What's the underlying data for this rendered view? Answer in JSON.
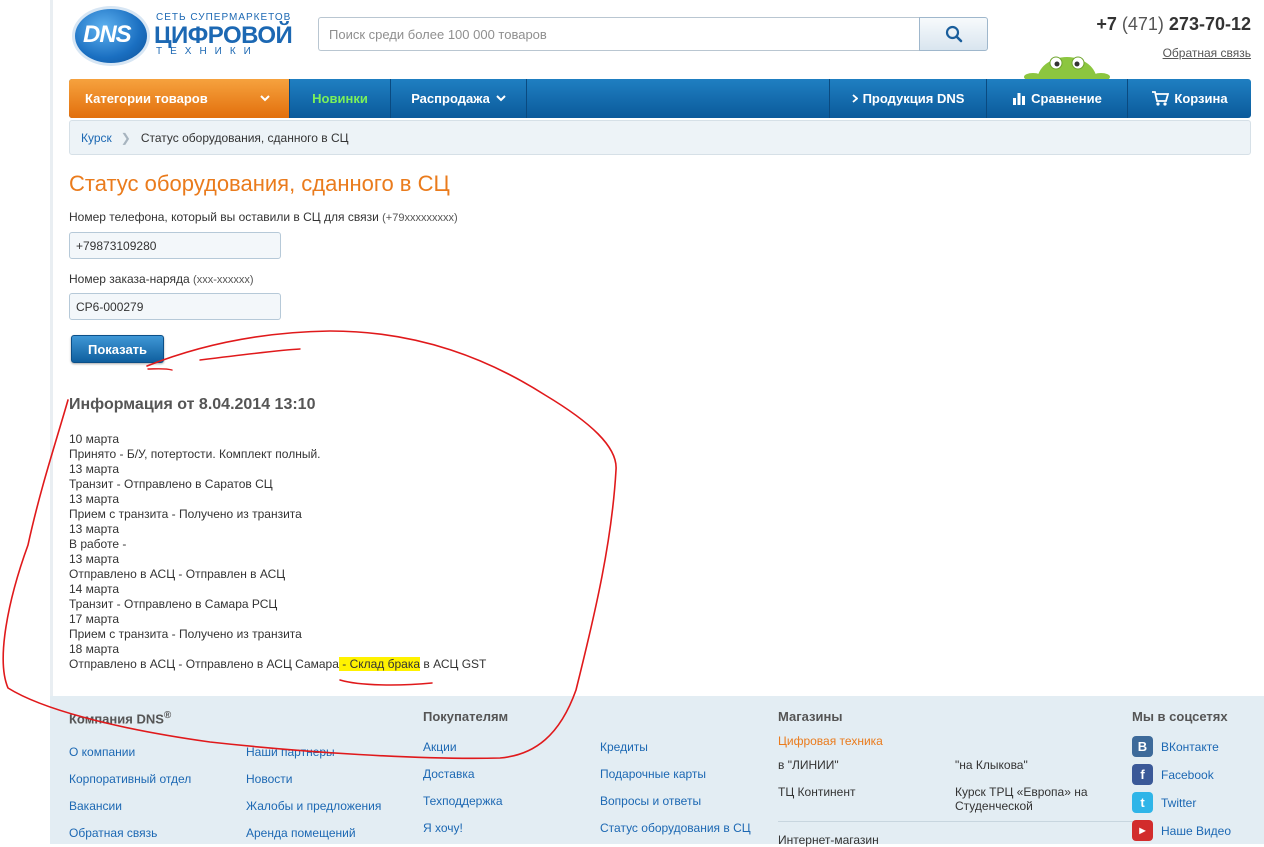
{
  "header": {
    "logo": {
      "brand": "DNS",
      "line1": "СЕТЬ СУПЕРМАРКЕТОВ",
      "line2": "ЦИФРОВОЙ",
      "line3": "ТЕХНИКИ"
    },
    "search_placeholder": "Поиск среди более 100 000 товаров",
    "phone_prefix": "+7",
    "phone_code": "(471)",
    "phone_number": "273-70-12",
    "feedback_link": "Обратная связь"
  },
  "nav": {
    "categories": "Категории товаров",
    "new": "Новинки",
    "sale": "Распродажа",
    "products": "Продукция DNS",
    "compare": "Сравнение",
    "cart": "Корзина"
  },
  "breadcrumb": {
    "home": "Курск",
    "current": "Статус оборудования, сданного в СЦ"
  },
  "form": {
    "title": "Статус оборудования, сданного в СЦ",
    "phone_label": "Номер телефона, который вы оставили в СЦ для связи",
    "phone_hint": "(+79xxxxxxxxx)",
    "phone_value": "+79873109280",
    "order_label": "Номер заказа-наряда",
    "order_hint": "(xxx-xxxxxx)",
    "order_value": "CP6-000279",
    "submit": "Показать"
  },
  "info": {
    "title": "Информация от 8.04.2014 13:10",
    "history": [
      "10 марта",
      "Принято - Б/У, потертости. Комплект полный.",
      "13 марта",
      "Транзит - Отправлено в Саратов СЦ",
      "13 марта",
      "Прием с транзита - Получено из транзита",
      "13 марта",
      "В работе -",
      "13 марта",
      "Отправлено в АСЦ - Отправлен в АСЦ",
      "14 марта",
      "Транзит - Отправлено в Самара РСЦ",
      "17 марта",
      "Прием с транзита - Получено из транзита",
      "18 марта"
    ],
    "last_pre": "Отправлено в АСЦ - Отправлено в АСЦ Самара",
    "last_highlight": " - Склад брака",
    "last_post": " в АСЦ GST"
  },
  "footer": {
    "company": {
      "title": "Компания DNS",
      "reg": "®",
      "col1": [
        "О компании",
        "Корпоративный отдел",
        "Вакансии",
        "Обратная связь"
      ],
      "col2": [
        "Наши партнеры",
        "Новости",
        "Жалобы и предложения",
        "Аренда помещений"
      ]
    },
    "buyers": {
      "title": "Покупателям",
      "col1": [
        "Акции",
        "Доставка",
        "Техподдержка",
        "Я хочу!"
      ],
      "col2": [
        "Кредиты",
        "Подарочные карты",
        "Вопросы и ответы",
        "Статус оборудования в СЦ"
      ]
    },
    "stores": {
      "title": "Магазины",
      "digital": "Цифровая техника",
      "s1": "в \"ЛИНИИ\"",
      "s2": "\"на Клыкова\"",
      "s3": "ТЦ Континент",
      "s4": "Курск ТРЦ «Европа» на Студенческой",
      "online": "Интернет-магазин"
    },
    "social": {
      "title": "Мы в соцсетях",
      "vk": "ВКонтакте",
      "fb": "Facebook",
      "tw": "Twitter",
      "yt": "Наше Видео"
    }
  },
  "colors": {
    "accent_orange": "#ea7b1c",
    "nav_blue": "#0b5a9b",
    "link_blue": "#1c68b3",
    "highlight": "#fff200",
    "annotation_red": "#e0191b"
  }
}
